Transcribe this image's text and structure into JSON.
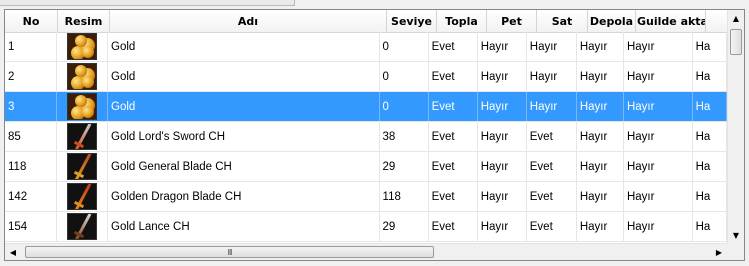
{
  "grid": {
    "columns": [
      "No",
      "Resim",
      "Adı",
      "Seviye",
      "Topla",
      "Pet",
      "Sat",
      "Depola",
      "Guilde aktar",
      ""
    ],
    "rows": [
      {
        "no": "1",
        "icon": "gold-coins-icon",
        "name": "Gold",
        "level": "0",
        "topla": "Evet",
        "pet": "Hayır",
        "sat": "Hayır",
        "depola": "Hayır",
        "guild": "Hayır",
        "extra": "Ha"
      },
      {
        "no": "2",
        "icon": "gold-coins-icon",
        "name": "Gold",
        "level": "0",
        "topla": "Evet",
        "pet": "Hayır",
        "sat": "Hayır",
        "depola": "Hayır",
        "guild": "Hayır",
        "extra": "Ha"
      },
      {
        "no": "3",
        "icon": "gold-coins-icon",
        "name": "Gold",
        "level": "0",
        "topla": "Evet",
        "pet": "Hayır",
        "sat": "Hayır",
        "depola": "Hayır",
        "guild": "Hayır",
        "extra": "Ha",
        "selected": true
      },
      {
        "no": "85",
        "icon": "sword-icon",
        "name": "Gold Lord's Sword CH",
        "level": "38",
        "topla": "Evet",
        "pet": "Hayır",
        "sat": "Evet",
        "depola": "Hayır",
        "guild": "Hayır",
        "extra": "Ha"
      },
      {
        "no": "118",
        "icon": "blade-icon",
        "name": "Gold General Blade CH",
        "level": "29",
        "topla": "Evet",
        "pet": "Hayır",
        "sat": "Evet",
        "depola": "Hayır",
        "guild": "Hayır",
        "extra": "Ha"
      },
      {
        "no": "142",
        "icon": "dragon-blade-icon",
        "name": "Golden Dragon Blade CH",
        "level": "118",
        "topla": "Evet",
        "pet": "Hayır",
        "sat": "Evet",
        "depola": "Hayır",
        "guild": "Hayır",
        "extra": "Ha"
      },
      {
        "no": "154",
        "icon": "lance-icon",
        "name": "Gold Lance CH",
        "level": "29",
        "topla": "Evet",
        "pet": "Hayır",
        "sat": "Evet",
        "depola": "Hayır",
        "guild": "Hayır",
        "extra": "Ha"
      }
    ]
  },
  "scrollbar": {
    "h_thumb_grip": "III"
  },
  "colors": {
    "selection": "#3399ff",
    "gold": "#e39a1b",
    "blade_red": "#c0391b"
  }
}
